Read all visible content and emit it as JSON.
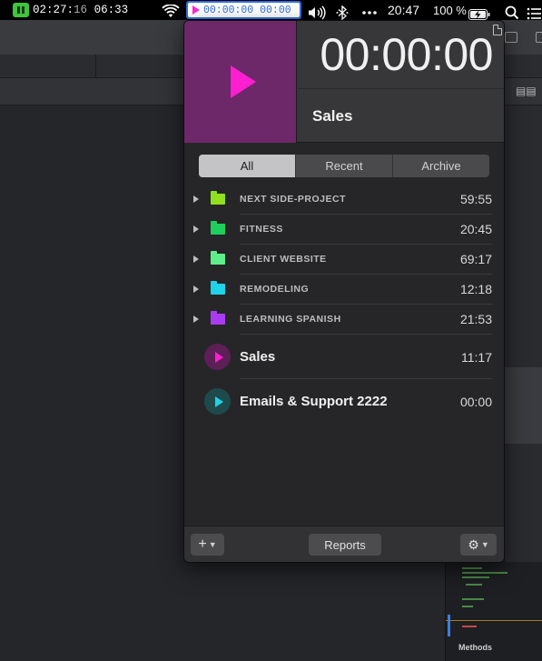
{
  "menubar": {
    "timer": {
      "elapsed_main": "02:27",
      "elapsed_seconds": "16",
      "remaining": "06:33",
      "color": "#3fc43f"
    },
    "tracker_display": "00:00:00 00:00",
    "clock": "20:47",
    "battery_percent": "100 %",
    "icons": [
      "pause-icon",
      "german-flag-icon",
      "wifi-icon",
      "play-icon",
      "volume-icon",
      "bluetooth-icon",
      "more-icon",
      "battery-charging-icon",
      "search-icon",
      "list-icon"
    ]
  },
  "popover": {
    "big_timer": "00:00:00",
    "current_task": "Sales",
    "play_tile_color": "#6c2868",
    "accent_color": "#ff1fd0",
    "tabs": [
      {
        "label": "All",
        "active": true
      },
      {
        "label": "Recent",
        "active": false
      },
      {
        "label": "Archive",
        "active": false
      }
    ],
    "projects": [
      {
        "name": "NEXT SIDE-PROJECT",
        "time": "59:55",
        "color": "#8fe01e"
      },
      {
        "name": "FITNESS",
        "time": "20:45",
        "color": "#1fcf5c"
      },
      {
        "name": "CLIENT WEBSITE",
        "time": "69:17",
        "color": "#5fef8a"
      },
      {
        "name": "REMODELING",
        "time": "12:18",
        "color": "#1fd3e8"
      },
      {
        "name": "LEARNING SPANISH",
        "time": "21:53",
        "color": "#a93cf0"
      }
    ],
    "tasks": [
      {
        "name": "Sales",
        "time": "11:17",
        "icon_bg": "#5c1f56",
        "icon_color": "#ff1fd0"
      },
      {
        "name": "Emails & Support 2222",
        "time": "00:00",
        "icon_bg": "#1f4a4c",
        "icon_color": "#1fd3e8"
      }
    ],
    "footer": {
      "add_label": "+",
      "reports_label": "Reports",
      "settings_icon": "gear-icon"
    }
  },
  "background": {
    "methods_label": "Methods"
  }
}
